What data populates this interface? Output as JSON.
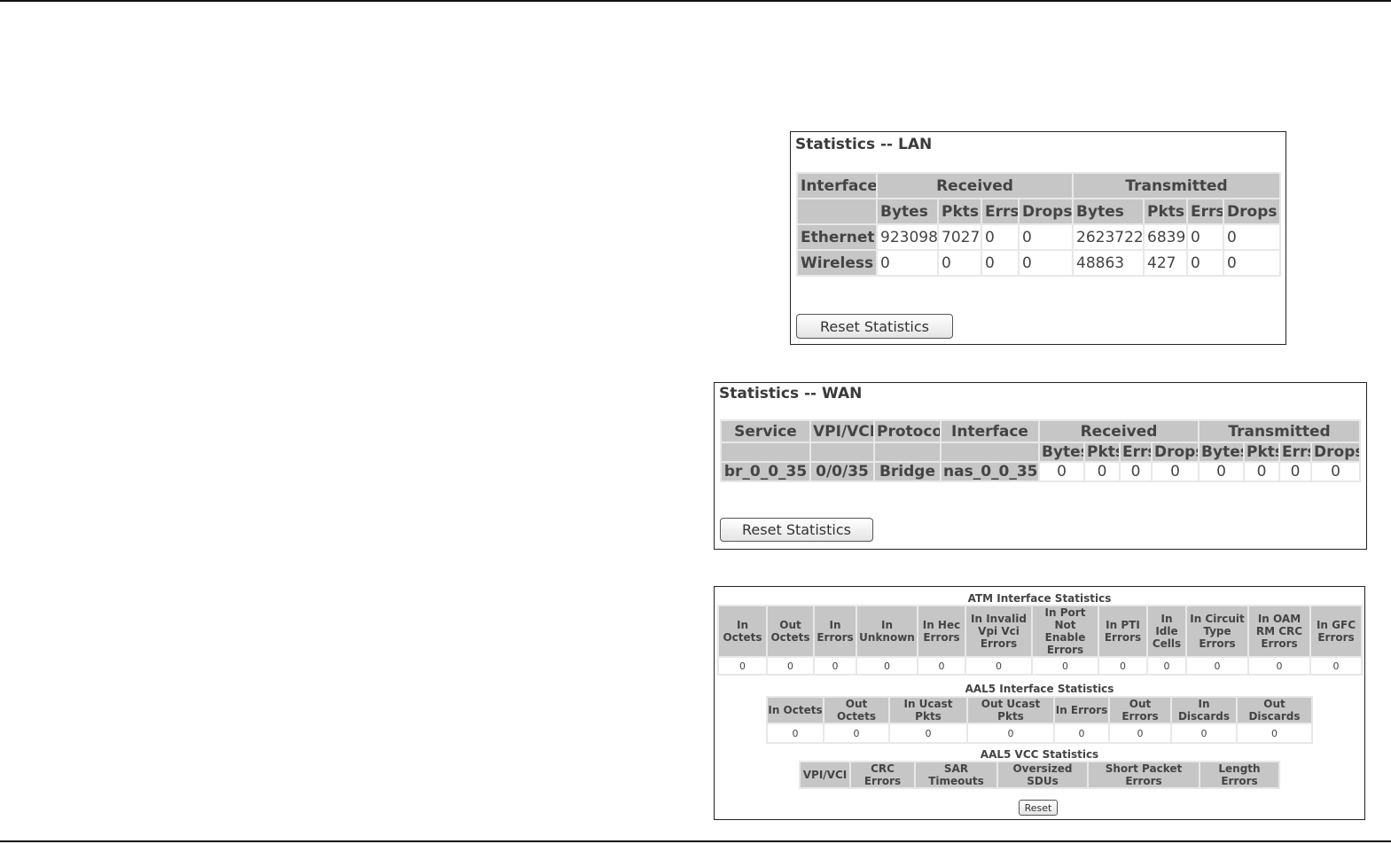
{
  "lan": {
    "title": "Statistics -- LAN",
    "headers": {
      "interface": "Interface",
      "received": "Received",
      "transmitted": "Transmitted"
    },
    "sub_headers": [
      "Bytes",
      "Pkts",
      "Errs",
      "Drops",
      "Bytes",
      "Pkts",
      "Errs",
      "Drops"
    ],
    "rows": [
      {
        "name": "Ethernet",
        "values": [
          "923098",
          "7027",
          "0",
          "0",
          "2623722",
          "6839",
          "0",
          "0"
        ]
      },
      {
        "name": "Wireless",
        "values": [
          "0",
          "0",
          "0",
          "0",
          "48863",
          "427",
          "0",
          "0"
        ]
      }
    ],
    "reset_label": "Reset Statistics"
  },
  "wan": {
    "title": "Statistics -- WAN",
    "headers": {
      "service": "Service",
      "vpi_vci": "VPI/VCI",
      "protocol": "Protocol",
      "interface": "Interface",
      "received": "Received",
      "transmitted": "Transmitted"
    },
    "sub_headers": [
      "Bytes",
      "Pkts",
      "Errs",
      "Drops",
      "Bytes",
      "Pkts",
      "Errs",
      "Drops"
    ],
    "rows": [
      {
        "service": "br_0_0_35",
        "vpi_vci": "0/0/35",
        "protocol": "Bridge",
        "interface": "nas_0_0_35",
        "values": [
          "0",
          "0",
          "0",
          "0",
          "0",
          "0",
          "0",
          "0"
        ]
      }
    ],
    "reset_label": "Reset Statistics"
  },
  "atm": {
    "title": "ATM Interface Statistics",
    "headers": [
      "In Octets",
      "Out Octets",
      "In Errors",
      "In Unknown",
      "In Hec Errors",
      "In Invalid Vpi Vci Errors",
      "In Port Not Enable Errors",
      "In PTI Errors",
      "In Idle Cells",
      "In Circuit Type Errors",
      "In OAM RM CRC Errors",
      "In GFC Errors"
    ],
    "values": [
      "0",
      "0",
      "0",
      "0",
      "0",
      "0",
      "0",
      "0",
      "0",
      "0",
      "0",
      "0"
    ]
  },
  "aal5": {
    "title": "AAL5 Interface Statistics",
    "headers": [
      "In Octets",
      "Out Octets",
      "In Ucast Pkts",
      "Out Ucast Pkts",
      "In Errors",
      "Out Errors",
      "In Discards",
      "Out Discards"
    ],
    "values": [
      "0",
      "0",
      "0",
      "0",
      "0",
      "0",
      "0",
      "0"
    ]
  },
  "vcc": {
    "title": "AAL5 VCC Statistics",
    "headers": [
      "VPI/VCI",
      "CRC Errors",
      "SAR Timeouts",
      "Oversized SDUs",
      "Short Packet Errors",
      "Length Errors"
    ]
  },
  "reset_label": "Reset"
}
